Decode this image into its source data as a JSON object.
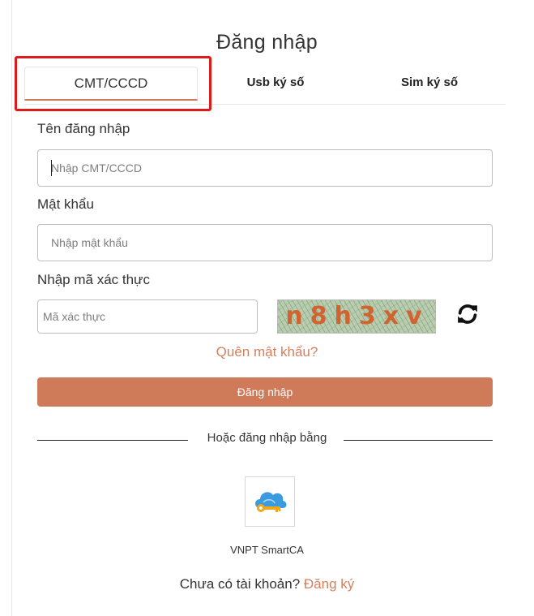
{
  "title": "Đăng nhập",
  "tabs": [
    {
      "label": "CMT/CCCD",
      "active": true
    },
    {
      "label": "Usb ký số",
      "active": false
    },
    {
      "label": "Sim ký số",
      "active": false
    }
  ],
  "form": {
    "username": {
      "label": "Tên đăng nhập",
      "placeholder": "Nhập CMT/CCCD",
      "value": ""
    },
    "password": {
      "label": "Mật khẩu",
      "placeholder": "Nhập mật khẩu",
      "value": ""
    },
    "captcha": {
      "label": "Nhập mã xác thực",
      "placeholder": "Mã xác thực",
      "value": "",
      "image_text": "n8h3xv"
    },
    "forgot_password": "Quên mật khẩu?",
    "submit_label": "Đăng nhập"
  },
  "alt_login": {
    "divider_text": "Hoặc đăng nhập bằng",
    "provider_label": "VNPT SmartCA",
    "provider_icon": "cloud-key-icon"
  },
  "signup": {
    "prompt": "Chưa có tài khoản?",
    "link": "Đăng ký"
  },
  "colors": {
    "accent": "#cf7b5a",
    "link": "#d4805f",
    "highlight_border": "#e01a1a"
  }
}
